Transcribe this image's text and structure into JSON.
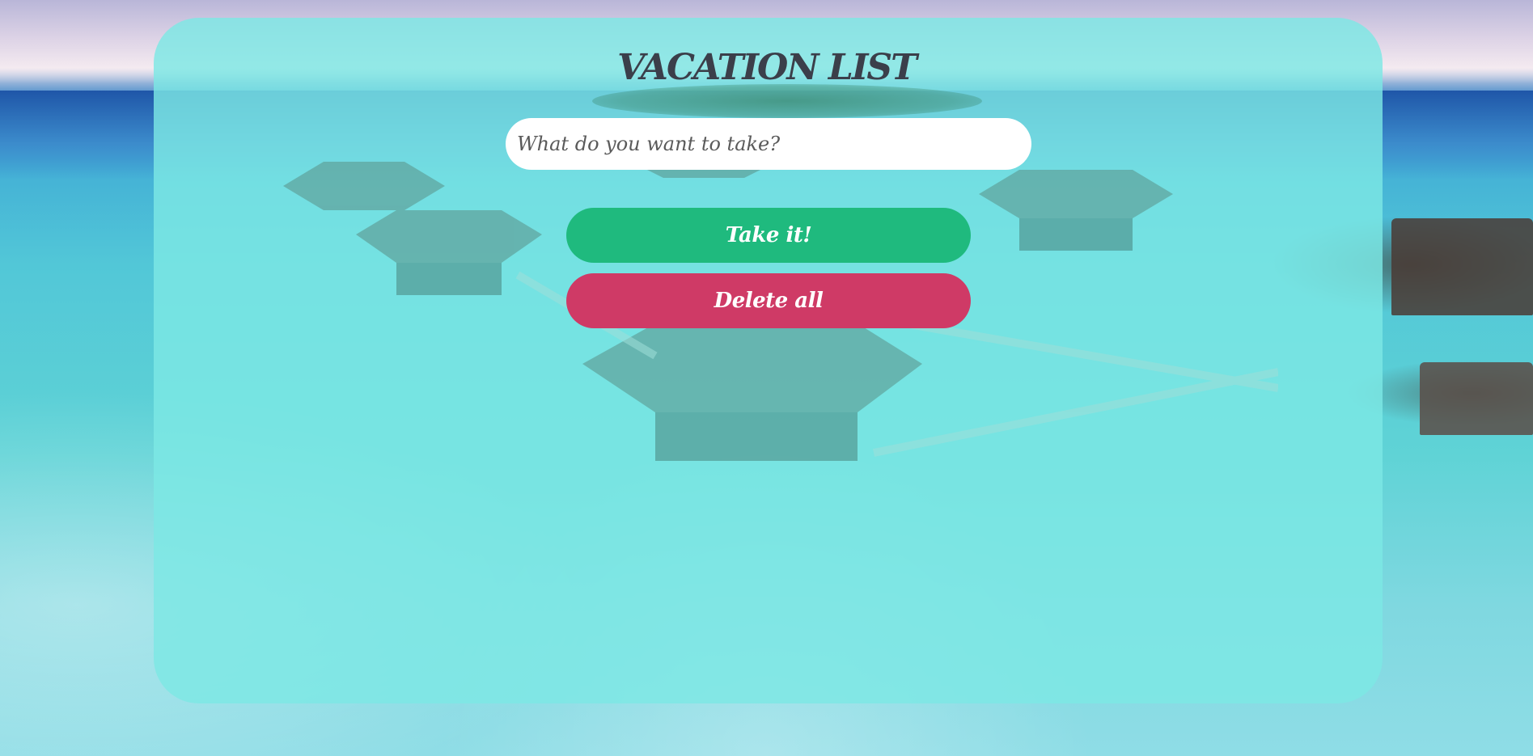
{
  "app": {
    "title": "VACATION LIST"
  },
  "form": {
    "input_placeholder": "What do you want to take?",
    "input_value": ""
  },
  "buttons": {
    "take_label": "Take it!",
    "delete_label": "Delete all"
  },
  "colors": {
    "panel": "#7de8e4",
    "take_button": "#1fba7e",
    "delete_button": "#cf3a66",
    "title_text": "#3b3f4a"
  }
}
